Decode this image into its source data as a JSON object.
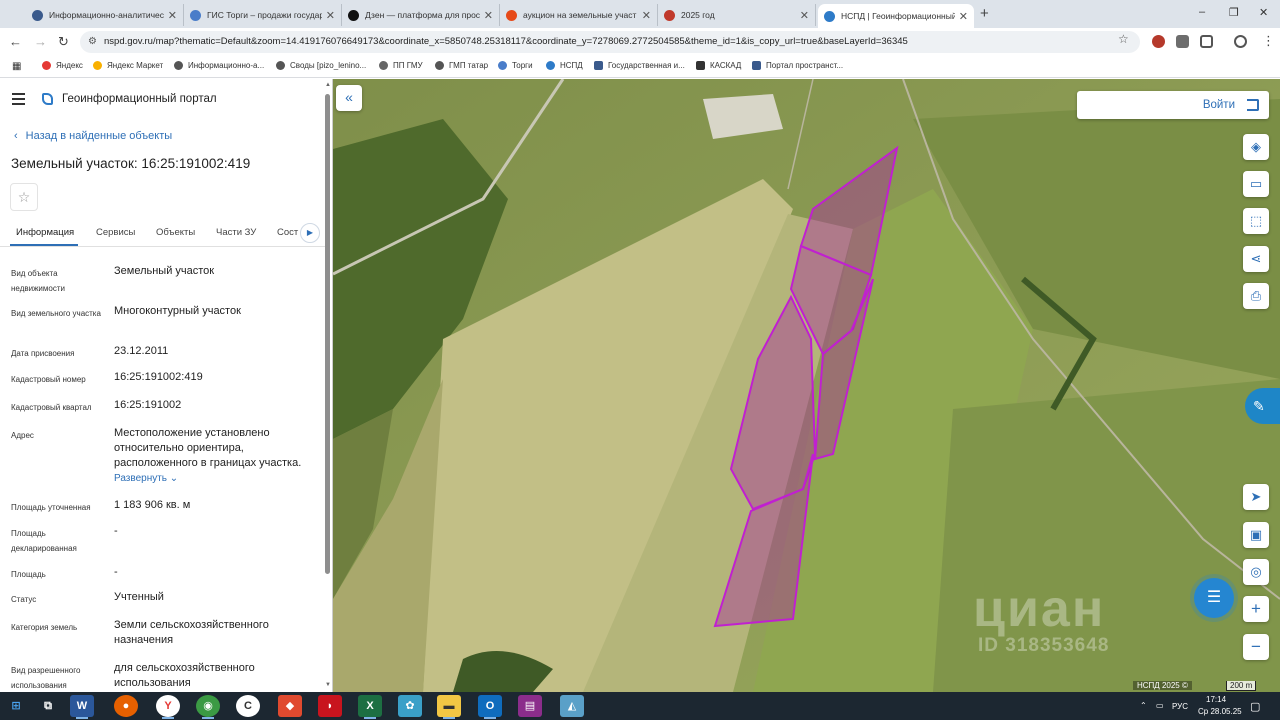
{
  "browser": {
    "tabs": [
      {
        "title": "Информационно-аналитичес",
        "color": "#3a5a8c"
      },
      {
        "title": "ГИС Торги – продажи государ",
        "color": "#4a7dc9"
      },
      {
        "title": "Дзен — платформа для прос",
        "color": "#111111"
      },
      {
        "title": "аукцион на земельные участ",
        "color": "#e64a19"
      },
      {
        "title": "2025 год",
        "color": "#c0392b"
      },
      {
        "title": "НСПД | Геоинформационный",
        "color": "#2e7bc8"
      }
    ],
    "url": "nspd.gov.ru/map?thematic=Default&zoom=14.419176076649173&coordinate_x=5850748.25318117&coordinate_y=7278069.2772504585&theme_id=1&is_copy_url=true&baseLayerId=36345",
    "bookmarks": [
      {
        "label": "Яндекс",
        "color": "#e53935"
      },
      {
        "label": "Яндекс Маркет",
        "color": "#f9b000"
      },
      {
        "label": "Информационно-а...",
        "color": "#555555"
      },
      {
        "label": "Своды [pizo_lenino...",
        "color": "#555555"
      },
      {
        "label": "ПП ГМУ",
        "color": "#666666"
      },
      {
        "label": "ГМП татар",
        "color": "#555555"
      },
      {
        "label": "Торги",
        "color": "#4a7dc9"
      },
      {
        "label": "НСПД",
        "color": "#2e7bc8"
      },
      {
        "label": "Государственная и...",
        "color": "#3a5a8c"
      },
      {
        "label": "КАСКАД",
        "color": "#333333"
      },
      {
        "label": "Портал пространст...",
        "color": "#3a5a8c"
      }
    ]
  },
  "panel": {
    "portal_title": "Геоинформационный портал",
    "back_link": "Назад в найденные объекты",
    "object_title": "Земельный участок: 16:25:191002:419",
    "tabs": [
      "Информация",
      "Сервисы",
      "Объекты",
      "Части ЗУ",
      "Сост"
    ],
    "properties": [
      {
        "label": "Вид объекта недвижимости",
        "value": "Земельный участок"
      },
      {
        "label": "Вид земельного участка",
        "value": "Многоконтурный участок"
      },
      {
        "label": "Дата присвоения",
        "value": "23.12.2011"
      },
      {
        "label": "Кадастровый номер",
        "value": "16:25:191002:419"
      },
      {
        "label": "Кадастровый квартал",
        "value": "16:25:191002"
      },
      {
        "label": "Адрес",
        "value": "Местоположение установлено относительно ориентира, расположенного в границах участка.",
        "expand": "Развернуть"
      },
      {
        "label": "Площадь уточненная",
        "value": "1 183 906 кв. м"
      },
      {
        "label": "Площадь декларированная",
        "value": "-"
      },
      {
        "label": "Площадь",
        "value": "-"
      },
      {
        "label": "Статус",
        "value": "Учтенный"
      },
      {
        "label": "Категория земель",
        "value": "Земли сельскохозяйственного назначения"
      },
      {
        "label": "Вид разрешенного использования",
        "value": "для сельскохозяйственного использования"
      }
    ]
  },
  "map": {
    "login_label": "Войти",
    "watermark": "циан",
    "watermark_id": "ID 318353648",
    "attribution": "НСПД 2025 ©",
    "scale": "200 m",
    "parcel_color": "#b41ec8"
  },
  "taskbar": {
    "lang": "РУС",
    "time": "17:14",
    "date": "Ср 28.05.25"
  }
}
